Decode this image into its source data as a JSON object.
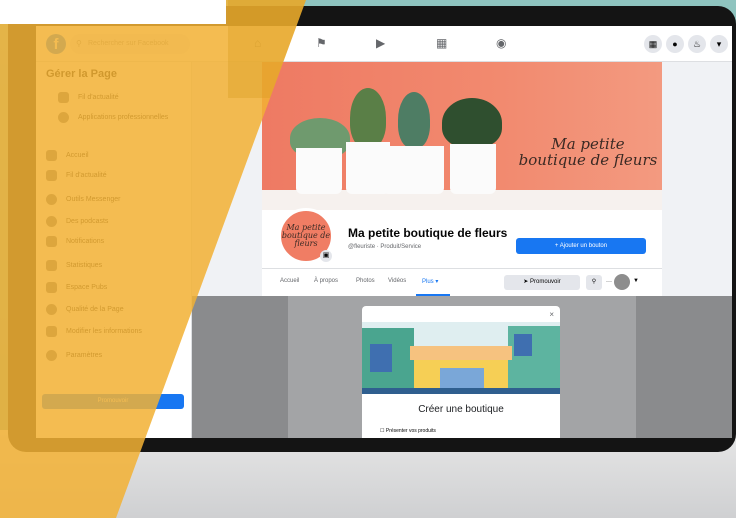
{
  "topbar": {
    "search_placeholder": "Rechercher sur Facebook",
    "nav_icons": [
      "home-icon",
      "pages-icon",
      "watch-icon",
      "marketplace-icon",
      "groups-icon"
    ],
    "right_icons": [
      "menu-icon",
      "messenger-icon",
      "notifications-icon",
      "account-icon"
    ]
  },
  "sidebar": {
    "title": "Gérer la Page",
    "top_items": [
      {
        "label": "Fil d'actualité"
      },
      {
        "label": "Applications professionnelles"
      }
    ],
    "items": [
      {
        "label": "Accueil"
      },
      {
        "label": "Fil d'actualité"
      },
      {
        "label": "Outils Messenger"
      },
      {
        "label": "Des podcasts"
      },
      {
        "label": "Notifications"
      },
      {
        "label": "Statistiques"
      },
      {
        "label": "Espace Pubs"
      },
      {
        "label": "Qualité de la Page"
      },
      {
        "label": "Modifier les informations"
      },
      {
        "label": "Paramètres"
      }
    ],
    "promote_label": "Promouvoir"
  },
  "page": {
    "cover_text": "Ma petite boutique de fleurs",
    "profile_text": "Ma petite boutique de fleurs",
    "name": "Ma petite boutique de fleurs",
    "meta": "@fleuriste · Produit/Service",
    "add_button": "+ Ajouter un bouton",
    "tabs": [
      "Accueil",
      "À propos",
      "Photos",
      "Vidéos",
      "Plus ▾"
    ],
    "promote_button": "Promouvoir",
    "search_icon": "search-icon",
    "more_label": "···"
  },
  "modal": {
    "title": "Créer une boutique",
    "step": "Présenter vos produits",
    "close": "×"
  },
  "colors": {
    "facebook_blue": "#1877f2",
    "cover_orange": "#ee7a63",
    "yellow_overlay": "#f2b134"
  }
}
